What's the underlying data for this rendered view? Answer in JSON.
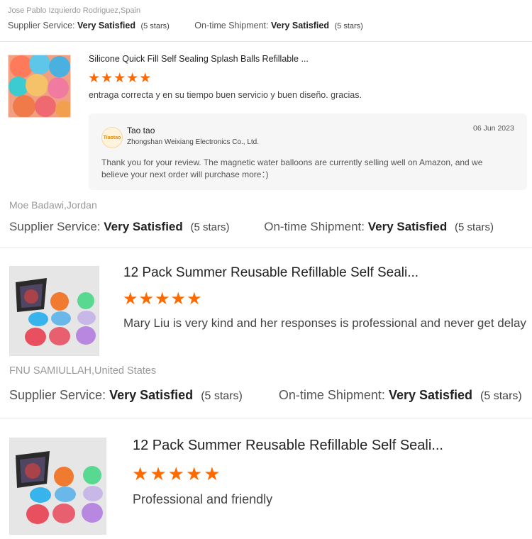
{
  "reviews": [
    {
      "reviewer": "Jose Pablo Izquierdo Rodriguez,Spain",
      "supplier_label": "Supplier Service:",
      "supplier_value": "Very Satisfied",
      "supplier_stars": "(5 stars)",
      "shipment_label": "On-time Shipment:",
      "shipment_value": "Very Satisfied",
      "shipment_stars": "(5 stars)",
      "product_title": "Silicone Quick Fill Self Sealing Splash Balls Refillable ...",
      "rating": 5,
      "comment": "entraga correcta y en su tiempo buen servicio y buen diseño. gracias.",
      "reply": {
        "logo_text": "Tiaotao",
        "name": "Tao tao",
        "company": "Zhongshan Weixiang Electronics Co., Ltd.",
        "date": "06 Jun 2023",
        "text_line1": "Thank you for your review. The magnetic water balloons are currently selling well on Amazon, and we",
        "text_line2": "believe your next order will purchase more：)"
      }
    },
    {
      "reviewer": "Moe Badawi,Jordan",
      "supplier_label": "Supplier Service:",
      "supplier_value": "Very Satisfied",
      "supplier_stars": "(5 stars)",
      "shipment_label": "On-time Shipment:",
      "shipment_value": "Very Satisfied",
      "shipment_stars": "(5 stars)",
      "product_title": "12 Pack Summer Reusable Refillable Self Seali...",
      "rating": 5,
      "comment": "Mary Liu is very kind and her responses is professional and never get delay"
    },
    {
      "reviewer": "FNU SAMIULLAH,United States",
      "supplier_label": "Supplier Service:",
      "supplier_value": "Very Satisfied",
      "supplier_stars": "(5 stars)",
      "shipment_label": "On-time Shipment:",
      "shipment_value": "Very Satisfied",
      "shipment_stars": "(5 stars)",
      "product_title": "12 Pack Summer Reusable Refillable Self Seali...",
      "rating": 5,
      "comment": "Professional and friendly"
    }
  ],
  "icons": {
    "star": "star-icon",
    "product_image": "water-balloons-image"
  },
  "colors": {
    "star": "#ff6a00"
  }
}
